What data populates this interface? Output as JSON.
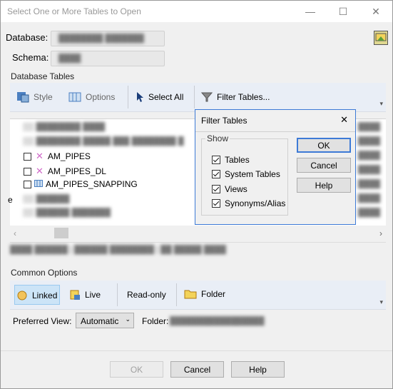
{
  "window": {
    "title": "Select One or More Tables to Open",
    "minimize": "—",
    "maximize": "☐",
    "close": "✕"
  },
  "fields": {
    "database_label": "Database:",
    "schema_label": "Schema:",
    "database_value": "",
    "schema_value": ""
  },
  "database_tables": {
    "group_label": "Database Tables",
    "toolbar": {
      "style": "Style",
      "options": "Options",
      "select_all": "Select All",
      "filter_tables": "Filter Tables..."
    },
    "items": [
      {
        "label": "AM_PIPES",
        "checked": false,
        "icon": "feature-class-icon"
      },
      {
        "label": "AM_PIPES_DL",
        "checked": false,
        "icon": "feature-class-icon"
      },
      {
        "label": "AM_PIPES_SNAPPING",
        "checked": false,
        "icon": "table-icon"
      }
    ],
    "left_edge_char": "e"
  },
  "filter_popup": {
    "title": "Filter Tables",
    "close": "✕",
    "show_label": "Show",
    "options": [
      {
        "label": "Tables",
        "checked": true
      },
      {
        "label": "System Tables",
        "checked": true
      },
      {
        "label": "Views",
        "checked": true
      },
      {
        "label": "Synonyms/Alias",
        "checked": true
      }
    ],
    "ok": "OK",
    "cancel": "Cancel",
    "help": "Help"
  },
  "common_options": {
    "group_label": "Common Options",
    "toolbar": {
      "linked": "Linked",
      "live": "Live",
      "read_only": "Read-only",
      "folder": "Folder"
    },
    "preferred_view_label": "Preferred View:",
    "preferred_view_value": "Automatic",
    "folder_label": "Folder:"
  },
  "footer": {
    "ok": "OK",
    "cancel": "Cancel",
    "help": "Help"
  },
  "colors": {
    "accent": "#3d7ad6",
    "toolbar_bg": "#e9eef6",
    "linked_bg": "#cce4f7"
  }
}
